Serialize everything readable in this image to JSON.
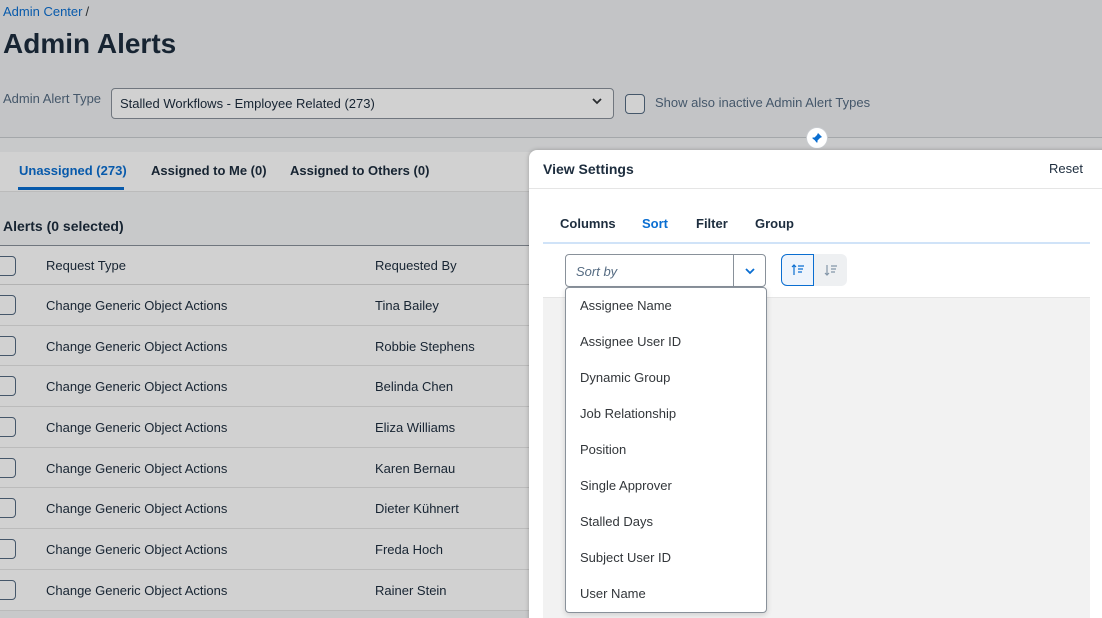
{
  "breadcrumb": {
    "root": "Admin Center",
    "separator": "/"
  },
  "page_title": "Admin Alerts",
  "alert_type": {
    "label": "Admin Alert Type",
    "selected": "Stalled Workflows - Employee Related (273)"
  },
  "inactive_checkbox": {
    "label": "Show also inactive Admin Alert Types",
    "checked": false
  },
  "tabs": [
    {
      "label": "Unassigned (273)",
      "active": true
    },
    {
      "label": "Assigned to Me (0)",
      "active": false
    },
    {
      "label": "Assigned to Others (0)",
      "active": false
    }
  ],
  "table": {
    "title": "Alerts (0 selected)",
    "columns": [
      "Request Type",
      "Requested By"
    ],
    "rows": [
      [
        "Change Generic Object Actions",
        "Tina Bailey"
      ],
      [
        "Change Generic Object Actions",
        "Robbie Stephens"
      ],
      [
        "Change Generic Object Actions",
        "Belinda Chen"
      ],
      [
        "Change Generic Object Actions",
        "Eliza Williams"
      ],
      [
        "Change Generic Object Actions",
        "Karen Bernau"
      ],
      [
        "Change Generic Object Actions",
        "Dieter Kühnert"
      ],
      [
        "Change Generic Object Actions",
        "Freda Hoch"
      ],
      [
        "Change Generic Object Actions",
        "Rainer Stein"
      ]
    ]
  },
  "view_settings": {
    "title": "View Settings",
    "reset_label": "Reset",
    "tabs": [
      {
        "label": "Columns",
        "active": false
      },
      {
        "label": "Sort",
        "active": true
      },
      {
        "label": "Filter",
        "active": false
      },
      {
        "label": "Group",
        "active": false
      }
    ],
    "sort_placeholder": "Sort by",
    "sort_options": [
      "Assignee Name",
      "Assignee User ID",
      "Dynamic Group",
      "Job Relationship",
      "Position",
      "Single Approver",
      "Stalled Days",
      "Subject User ID",
      "User Name"
    ]
  },
  "colors": {
    "accent": "#0a6ed1",
    "text": "#1d2d3e"
  }
}
